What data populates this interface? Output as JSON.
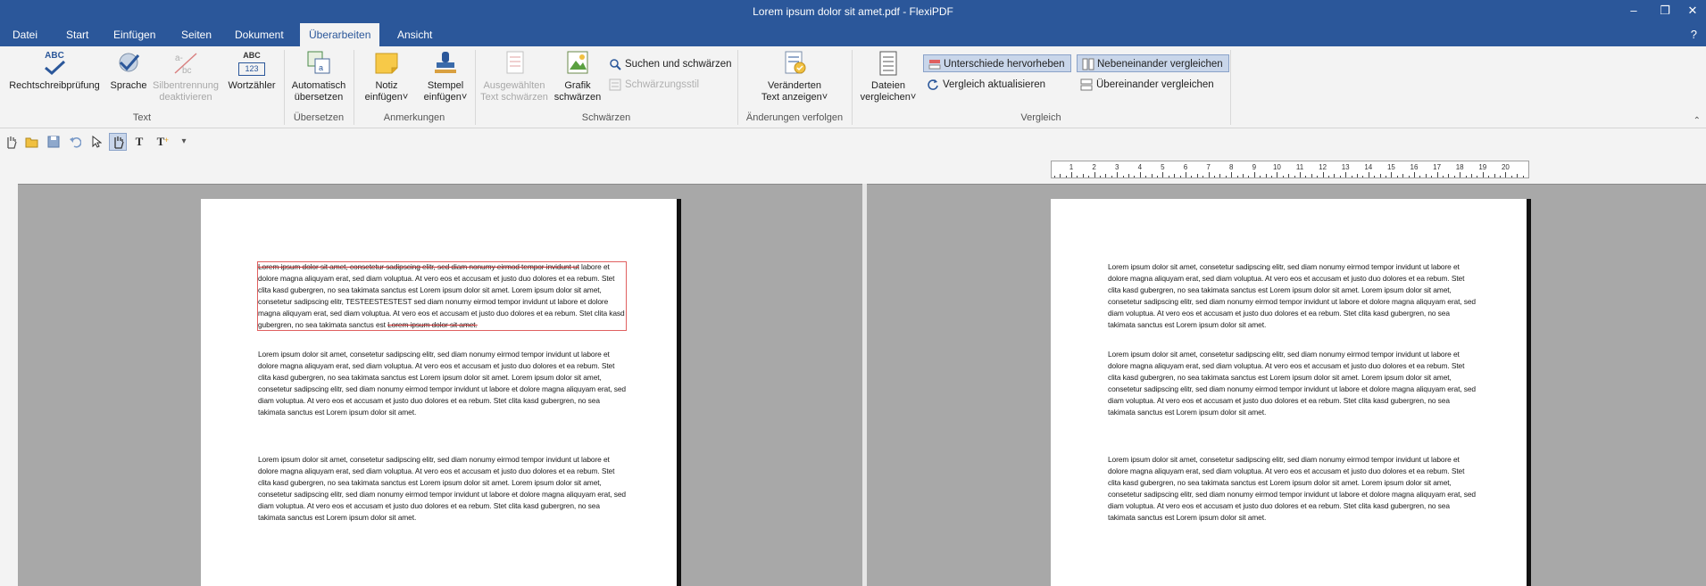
{
  "window": {
    "title": "Lorem ipsum dolor sit amet.pdf - FlexiPDF",
    "minimize": "–",
    "restore": "❐",
    "close": "✕"
  },
  "menu": {
    "tabs": [
      "Datei",
      "Start",
      "Einfügen",
      "Seiten",
      "Dokument",
      "Überarbeiten",
      "Ansicht"
    ],
    "active_index": 5,
    "help": "?"
  },
  "ribbon": {
    "groups": {
      "text": "Text",
      "uebersetzen": "Übersetzen",
      "anmerkungen": "Anmerkungen",
      "schwaerzen": "Schwärzen",
      "aenderungen": "Änderungen verfolgen",
      "vergleich": "Vergleich"
    },
    "buttons": {
      "rechtschreib": "Rechtschreibprüfung",
      "sprache": "Sprache",
      "silben_1": "Silbentrennung",
      "silben_2": "deaktivieren",
      "wortzaehler": "Wortzähler",
      "auto_1": "Automatisch",
      "auto_2": "übersetzen",
      "notiz_1": "Notiz",
      "notiz_2": "einfügen",
      "stempel_1": "Stempel",
      "stempel_2": "einfügen",
      "ausgew_1": "Ausgewählten",
      "ausgew_2": "Text schwärzen",
      "grafik_1": "Grafik",
      "grafik_2": "schwärzen",
      "suchen": "Suchen und schwärzen",
      "stil": "Schwärzungsstil",
      "veraend_1": "Veränderten",
      "veraend_2": "Text anzeigen",
      "dateien_1": "Dateien",
      "dateien_2": "vergleichen",
      "unterschiede": "Unterschiede hervorheben",
      "nebeneinander": "Nebeneinander vergleichen",
      "aktualisieren": "Vergleich aktualisieren",
      "uebereinander": "Übereinander vergleichen",
      "abc": "ABC",
      "num": "123",
      "dropdown": "˅"
    }
  },
  "qat": {
    "text_tool": "T",
    "text_add": "T",
    "more": "▾"
  },
  "ruler": {
    "ticks": [
      "1",
      "2",
      "3",
      "4",
      "5",
      "6",
      "7",
      "8",
      "9",
      "10",
      "11",
      "12",
      "13",
      "14",
      "15",
      "16",
      "17",
      "18",
      "19",
      "20"
    ]
  },
  "left_doc": {
    "p1_strike": "Lorem ipsum dolor sit amet, consetetur sadipscing elitr, sed diam nonumy eirmod tempor invidunt ut",
    "p1_rest": "labore et dolore magna aliquyam erat, sed diam voluptua. At vero eos et accusam et justo duo dolores et ea rebum. Stet clita kasd gubergren, no sea takimata sanctus est Lorem ipsum dolor sit amet. Lorem ipsum dolor sit amet, consetetur sadipscing elitr, TESTEESTESTEST sed diam nonumy eirmod tempor invidunt ut labore et dolore magna aliquyam erat, sed diam voluptua. At vero eos et accusam et justo duo dolores et ea rebum. Stet clita kasd gubergren, no sea takimata sanctus est",
    "p1_last": "Lorem ipsum dolor sit amet.",
    "p2": "Lorem ipsum dolor sit amet, consetetur sadipscing elitr, sed diam nonumy eirmod tempor invidunt ut labore et dolore magna aliquyam erat, sed diam voluptua. At vero eos et accusam et justo duo dolores et ea rebum. Stet clita kasd gubergren, no sea takimata sanctus est Lorem ipsum dolor sit amet. Lorem ipsum dolor sit amet, consetetur sadipscing elitr, sed diam nonumy eirmod tempor invidunt ut labore et dolore magna aliquyam erat, sed diam voluptua. At vero eos et accusam et justo duo dolores et ea rebum. Stet clita kasd gubergren, no sea takimata sanctus est Lorem ipsum dolor sit amet.",
    "p3": "Lorem ipsum dolor sit amet, consetetur sadipscing elitr, sed diam nonumy eirmod tempor invidunt ut labore et dolore magna aliquyam erat, sed diam voluptua. At vero eos et accusam et justo duo dolores et ea rebum. Stet clita kasd gubergren, no sea takimata sanctus est Lorem ipsum dolor sit amet. Lorem ipsum dolor sit amet, consetetur sadipscing elitr, sed diam nonumy eirmod tempor invidunt ut labore et dolore magna aliquyam erat, sed diam voluptua. At vero eos et accusam et justo duo dolores et ea rebum. Stet clita kasd gubergren, no sea takimata sanctus est Lorem ipsum dolor sit amet."
  },
  "right_doc": {
    "p1": "Lorem ipsum dolor sit amet, consetetur sadipscing elitr, sed diam nonumy eirmod tempor invidunt ut labore et dolore magna aliquyam erat, sed diam voluptua. At vero eos et accusam et justo duo dolores et ea rebum. Stet clita kasd gubergren, no sea takimata sanctus est Lorem ipsum dolor sit amet. Lorem ipsum dolor sit amet, consetetur sadipscing elitr, sed diam nonumy eirmod tempor invidunt ut labore et dolore magna aliquyam erat, sed diam voluptua. At vero eos et accusam et justo duo dolores et ea rebum. Stet clita kasd gubergren, no sea takimata sanctus est Lorem ipsum dolor sit amet.",
    "p2": "Lorem ipsum dolor sit amet, consetetur sadipscing elitr, sed diam nonumy eirmod tempor invidunt ut labore et dolore magna aliquyam erat, sed diam voluptua. At vero eos et accusam et justo duo dolores et ea rebum. Stet clita kasd gubergren, no sea takimata sanctus est Lorem ipsum dolor sit amet. Lorem ipsum dolor sit amet, consetetur sadipscing elitr, sed diam nonumy eirmod tempor invidunt ut labore et dolore magna aliquyam erat, sed diam voluptua. At vero eos et accusam et justo duo dolores et ea rebum. Stet clita kasd gubergren, no sea takimata sanctus est Lorem ipsum dolor sit amet.",
    "p3": "Lorem ipsum dolor sit amet, consetetur sadipscing elitr, sed diam nonumy eirmod tempor invidunt ut labore et dolore magna aliquyam erat, sed diam voluptua. At vero eos et accusam et justo duo dolores et ea rebum. Stet clita kasd gubergren, no sea takimata sanctus est Lorem ipsum dolor sit amet. Lorem ipsum dolor sit amet, consetetur sadipscing elitr, sed diam nonumy eirmod tempor invidunt ut labore et dolore magna aliquyam erat, sed diam voluptua. At vero eos et accusam et justo duo dolores et ea rebum. Stet clita kasd gubergren, no sea takimata sanctus est Lorem ipsum dolor sit amet."
  },
  "colors": {
    "titlebar": "#2b579a",
    "toggle_bg": "#c9d6ea",
    "highlight": "#e06060",
    "viewer_bg": "#a8a8a8"
  }
}
